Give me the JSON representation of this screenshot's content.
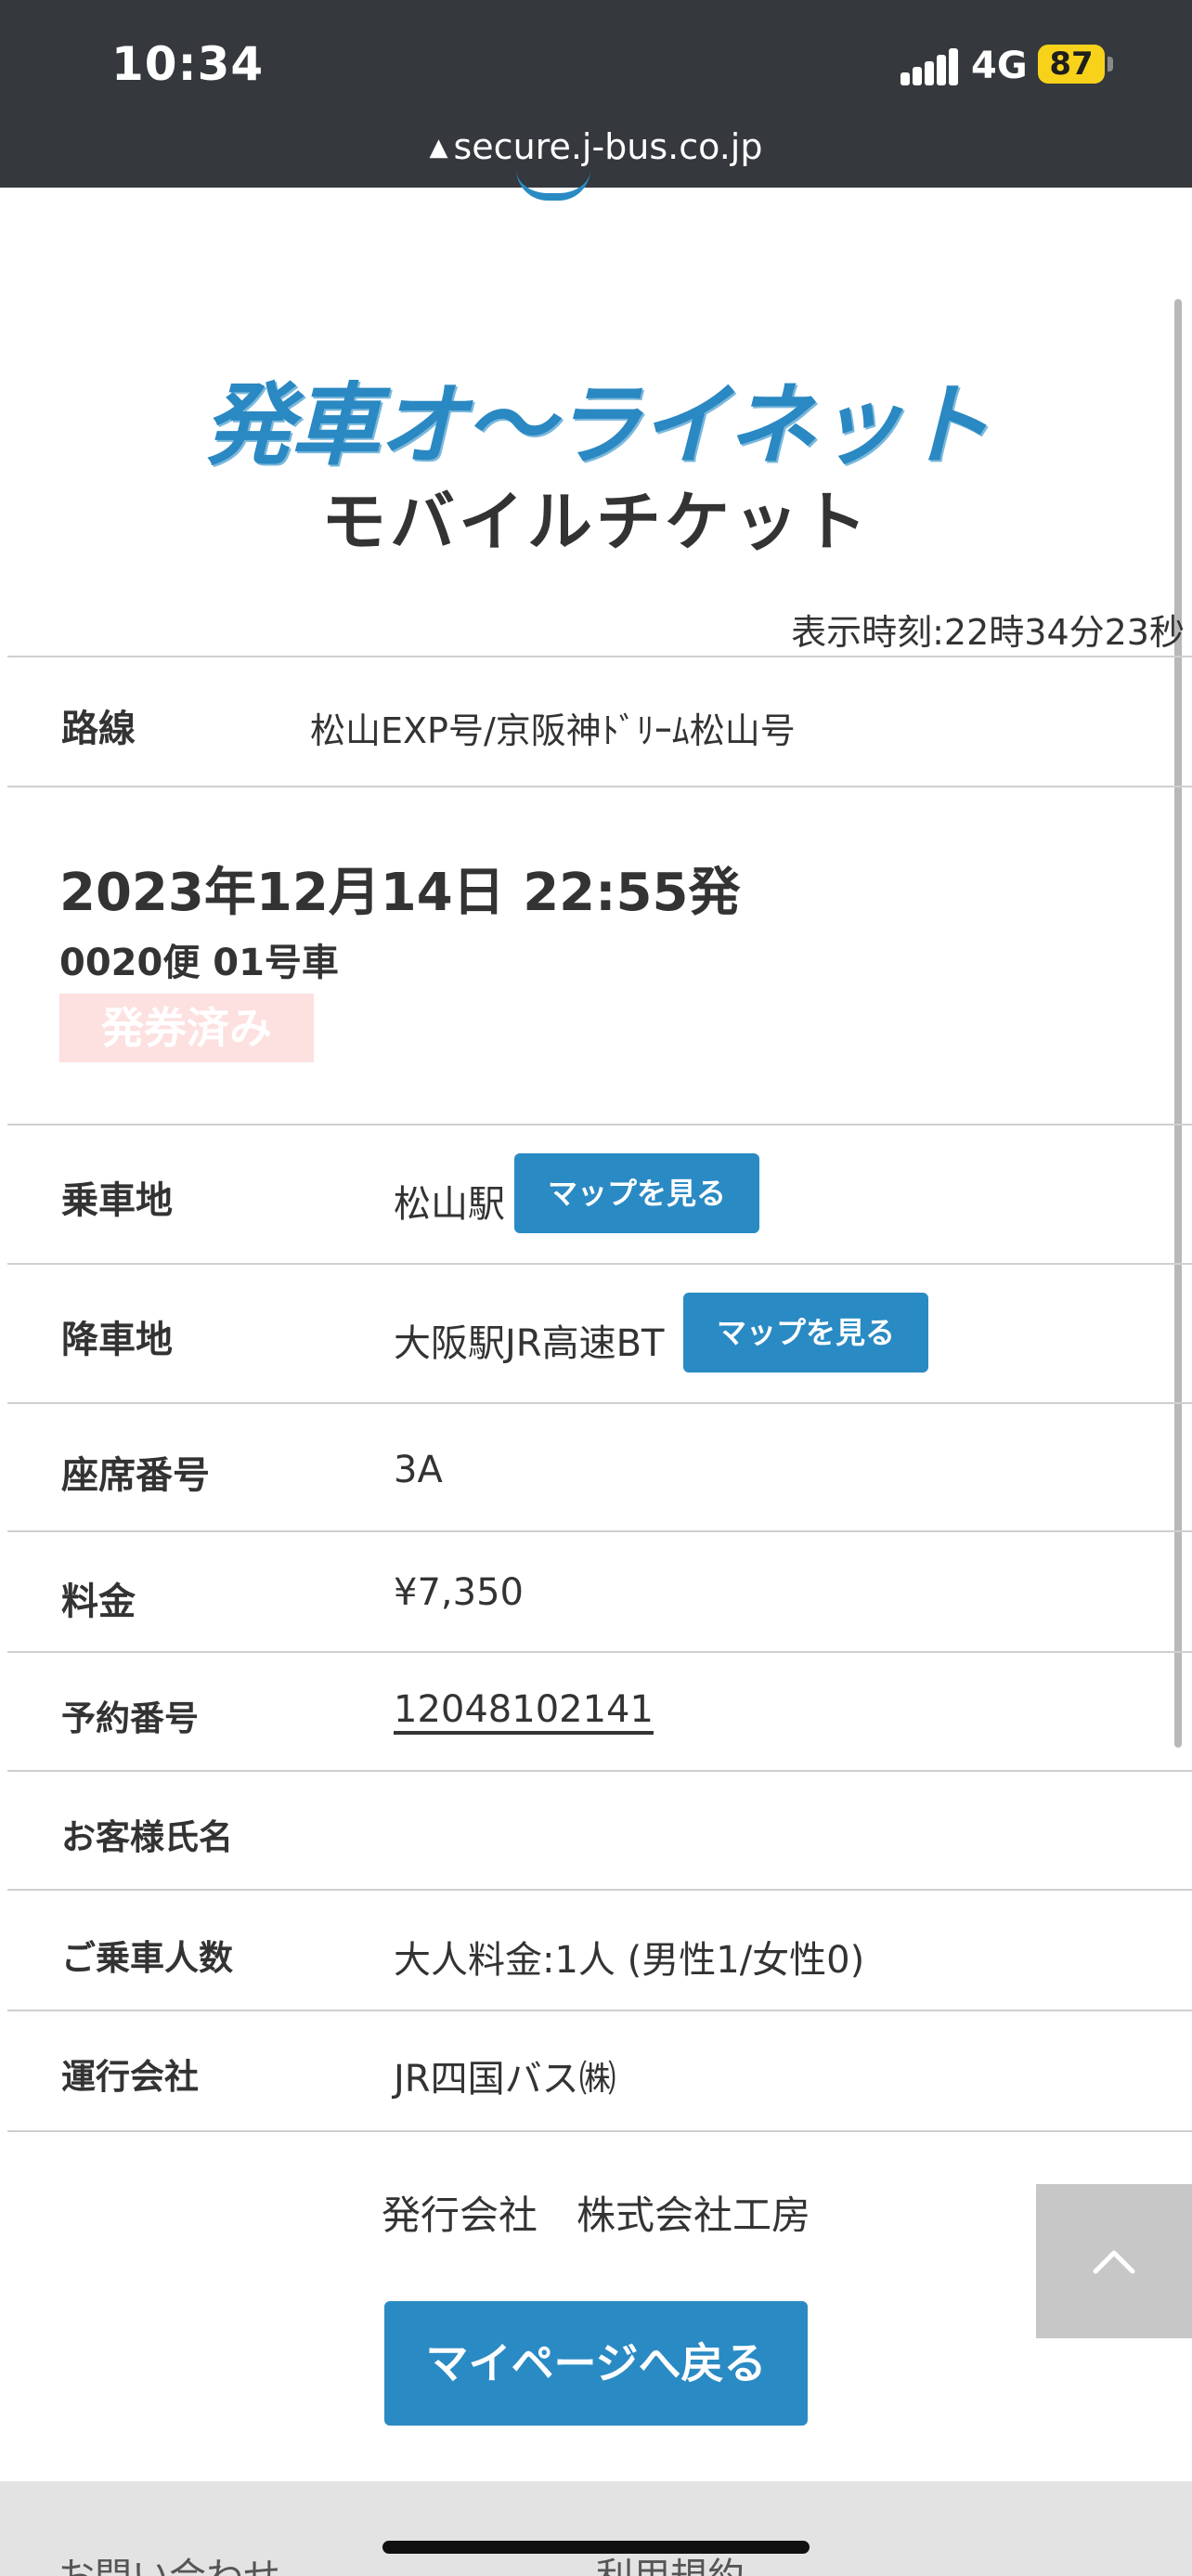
{
  "status_bar": {
    "time": "10:34",
    "network": "4G",
    "battery": "87"
  },
  "browser": {
    "url": "secure.j-bus.co.jp"
  },
  "header": {
    "logo_text": "発車オ～ライネット",
    "subtitle": "モバイルチケット",
    "display_time": "表示時刻:22時34分23秒"
  },
  "route": {
    "label": "路線",
    "value": "松山EXP号/京阪神ﾄﾞﾘｰﾑ松山号"
  },
  "trip": {
    "datetime": "2023年12月14日 22:55発",
    "bin_car": "0020便 01号車",
    "status_badge": "発券済み"
  },
  "details": {
    "boarding": {
      "label": "乗車地",
      "value": "松山駅",
      "map_button": "マップを見る"
    },
    "alighting": {
      "label": "降車地",
      "value": "大阪駅JR高速BT",
      "map_button": "マップを見る"
    },
    "seat": {
      "label": "座席番号",
      "value": "3A"
    },
    "fare": {
      "label": "料金",
      "value": "¥7,350"
    },
    "reservation": {
      "label": "予約番号",
      "value": "12048102141"
    },
    "customer": {
      "label": "お客様氏名",
      "value": ""
    },
    "passengers": {
      "label": "ご乗車人数",
      "value": "大人料金:1人 (男性1/女性0)"
    },
    "operator": {
      "label": "運行会社",
      "value": "JR四国バス㈱"
    }
  },
  "issuer": "発行会社　株式会社工房",
  "back_button": "マイページへ戻る",
  "footer": {
    "contact": "お問い合わせ",
    "terms": "利用規約"
  },
  "colors": {
    "accent": "#2a8ac4",
    "status_bar": "#35383c",
    "badge_bg": "#fde0e0",
    "battery": "#f8d21a"
  }
}
